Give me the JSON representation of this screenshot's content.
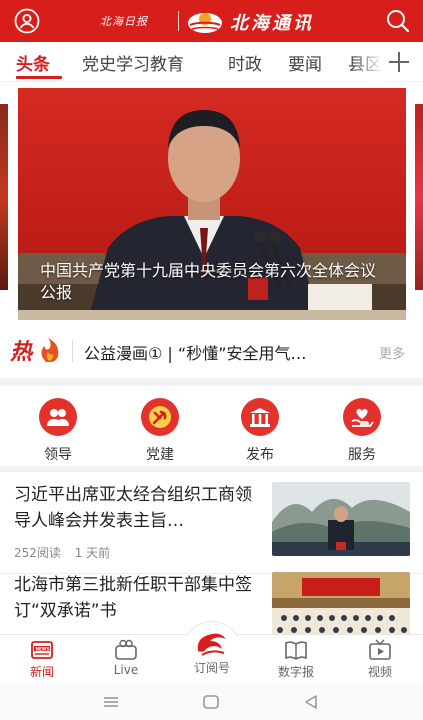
{
  "header": {
    "logo_left": "北海日报",
    "logo_right": "北海通讯"
  },
  "tabs": [
    {
      "label": "头条",
      "active": true
    },
    {
      "label": "党史学习教育"
    },
    {
      "label": "时政"
    },
    {
      "label": "要闻"
    },
    {
      "label": "县区"
    }
  ],
  "banner": {
    "caption": "中国共产党第十九届中央委员会第六次全体会议公报"
  },
  "hot": {
    "label": "热点",
    "text": "公益漫画① | “秒懂”安全用气…",
    "more": "更多"
  },
  "quick_menu": [
    {
      "label": "领导",
      "icon": "leader-icon"
    },
    {
      "label": "党建",
      "icon": "party-icon"
    },
    {
      "label": "发布",
      "icon": "release-icon"
    },
    {
      "label": "服务",
      "icon": "service-icon"
    }
  ],
  "news": [
    {
      "title": "习近平出席亚太经合组织工商领导人峰会并发表主旨…",
      "reads": "252阅读",
      "time": "1 天前"
    },
    {
      "title": "北海市第三批新任职干部集中签订“双承诺”书",
      "reads": "",
      "time": ""
    }
  ],
  "bottom_nav": [
    {
      "label": "新闻",
      "icon": "news-icon",
      "active": true
    },
    {
      "label": "Live",
      "icon": "live-icon"
    },
    {
      "label": "订阅号",
      "icon": "subscribe-icon"
    },
    {
      "label": "数字报",
      "icon": "digital-paper-icon"
    },
    {
      "label": "视频",
      "icon": "video-icon"
    }
  ],
  "colors": {
    "accent": "#d81e1b",
    "icon_bg": "#e2322b"
  }
}
